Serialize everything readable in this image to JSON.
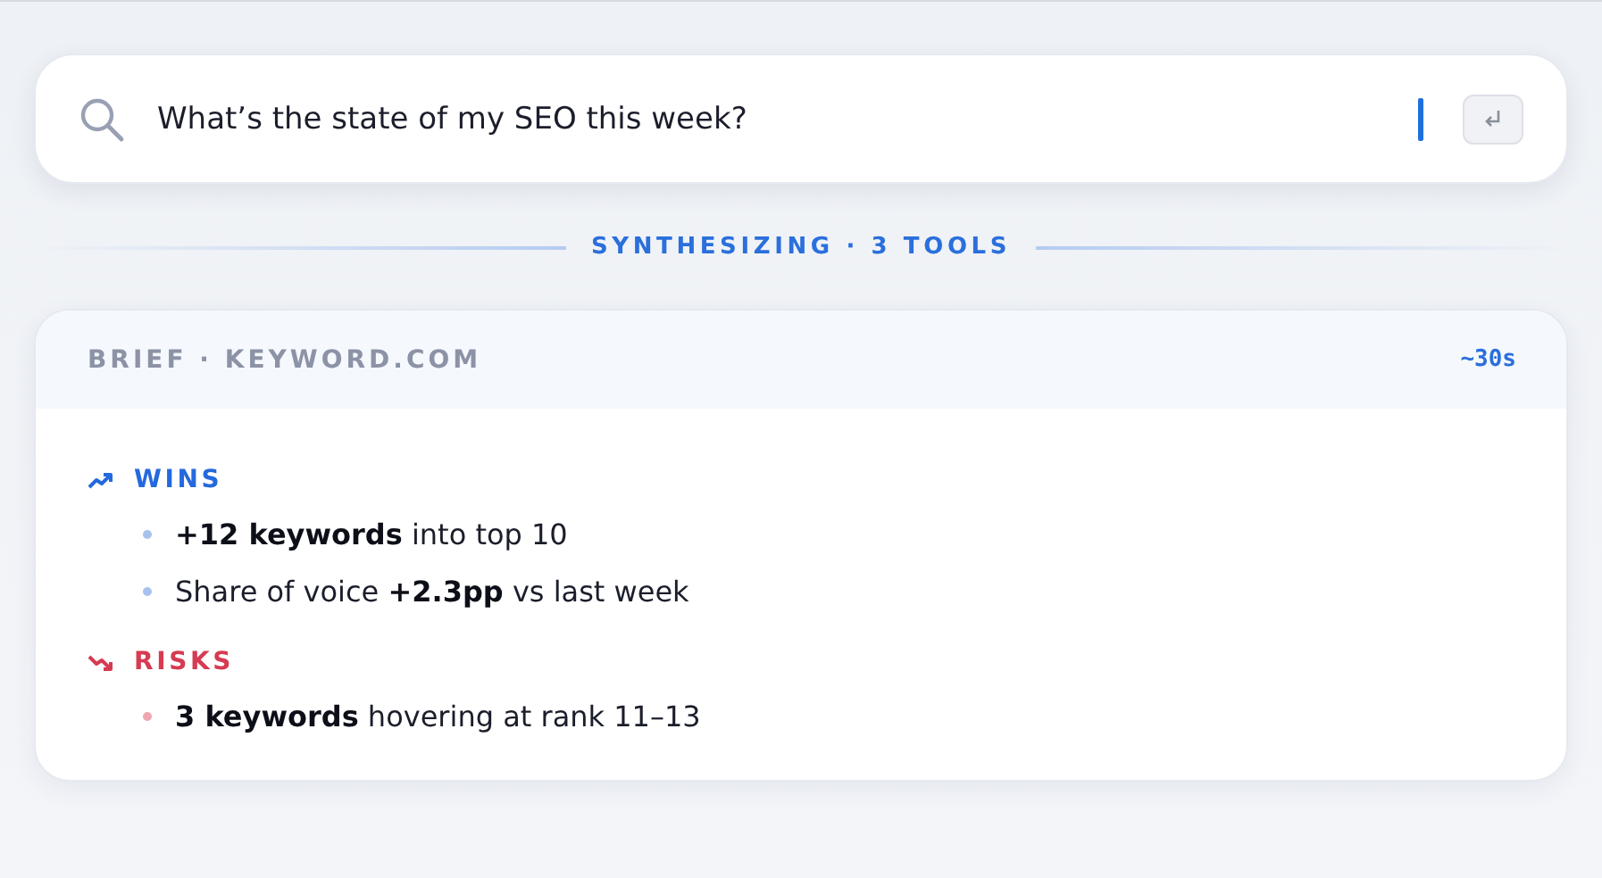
{
  "search": {
    "value": "What’s the state of my SEO this week?"
  },
  "status": "SYNTHESIZING · 3 TOOLS",
  "brief": {
    "title": "BRIEF · KEYWORD.COM",
    "eta": "~30s",
    "sections": [
      {
        "kind": "wins",
        "label": "WINS",
        "items": [
          "**+12 keywords** into top 10",
          "Share of voice **+2.3pp** vs last week"
        ]
      },
      {
        "kind": "risks",
        "label": "RISKS",
        "items": [
          "**3 keywords** hovering at rank 11–13"
        ]
      }
    ]
  }
}
